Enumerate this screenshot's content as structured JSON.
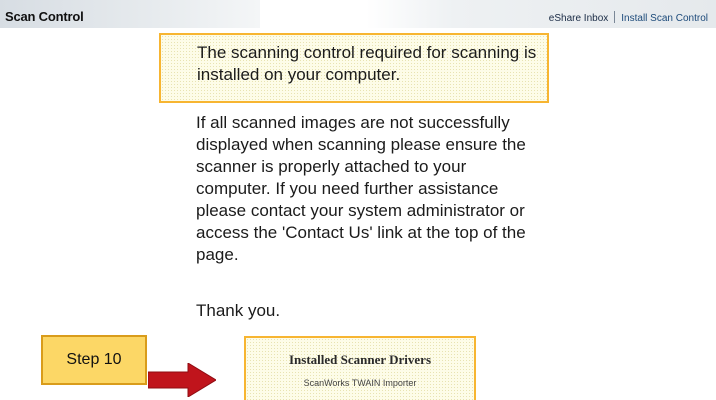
{
  "header": {
    "title": "Scan Control",
    "nav": {
      "inbox_label": "eShare Inbox",
      "install_label": "Install Scan Control"
    }
  },
  "status": {
    "message": "The scanning control required for scanning is installed on your computer."
  },
  "help": {
    "paragraph": "If all scanned images are not successfully displayed when scanning please ensure the scanner is properly attached to your computer. If you need further assistance please contact your system administrator or access the 'Contact Us' link at the top of the page.",
    "thanks": "Thank you."
  },
  "callout": {
    "step_label": "Step 10",
    "arrow_color": "#c0141c",
    "box_color": "#fcd766"
  },
  "drivers": {
    "title": "Installed Scanner Drivers",
    "items": [
      "ScanWorks TWAIN Importer"
    ]
  },
  "colors": {
    "highlight_border": "#f7b531",
    "highlight_fill": "#fdfce8"
  }
}
